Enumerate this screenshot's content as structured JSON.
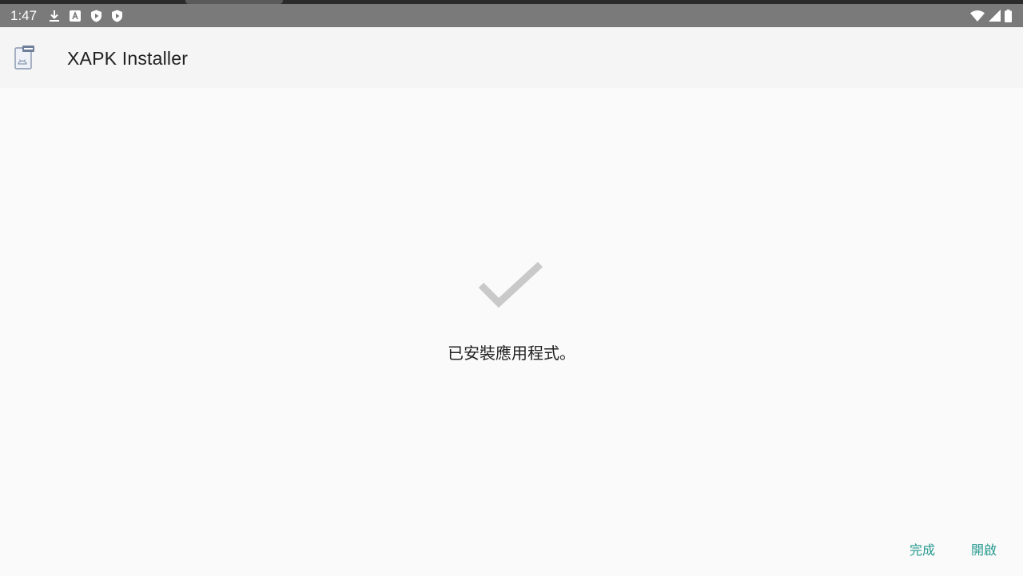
{
  "status_bar": {
    "time": "1:47",
    "icons": [
      "download-icon",
      "a-badge-icon",
      "shield-play-icon",
      "shield-play-icon-2"
    ],
    "right_icons": [
      "wifi-icon",
      "cell-signal-icon",
      "battery-icon"
    ]
  },
  "app_bar": {
    "title": "XAPK Installer",
    "icon": "xapk-app-icon"
  },
  "main": {
    "status_icon": "checkmark-icon",
    "message": "已安裝應用程式。"
  },
  "actions": {
    "done_label": "完成",
    "open_label": "開啟"
  },
  "colors": {
    "status_bar": "#7a7a7a",
    "app_bar": "#f5f5f5",
    "background": "#fafafa",
    "accent": "#26998f",
    "checkmark": "#c9c9c9"
  }
}
